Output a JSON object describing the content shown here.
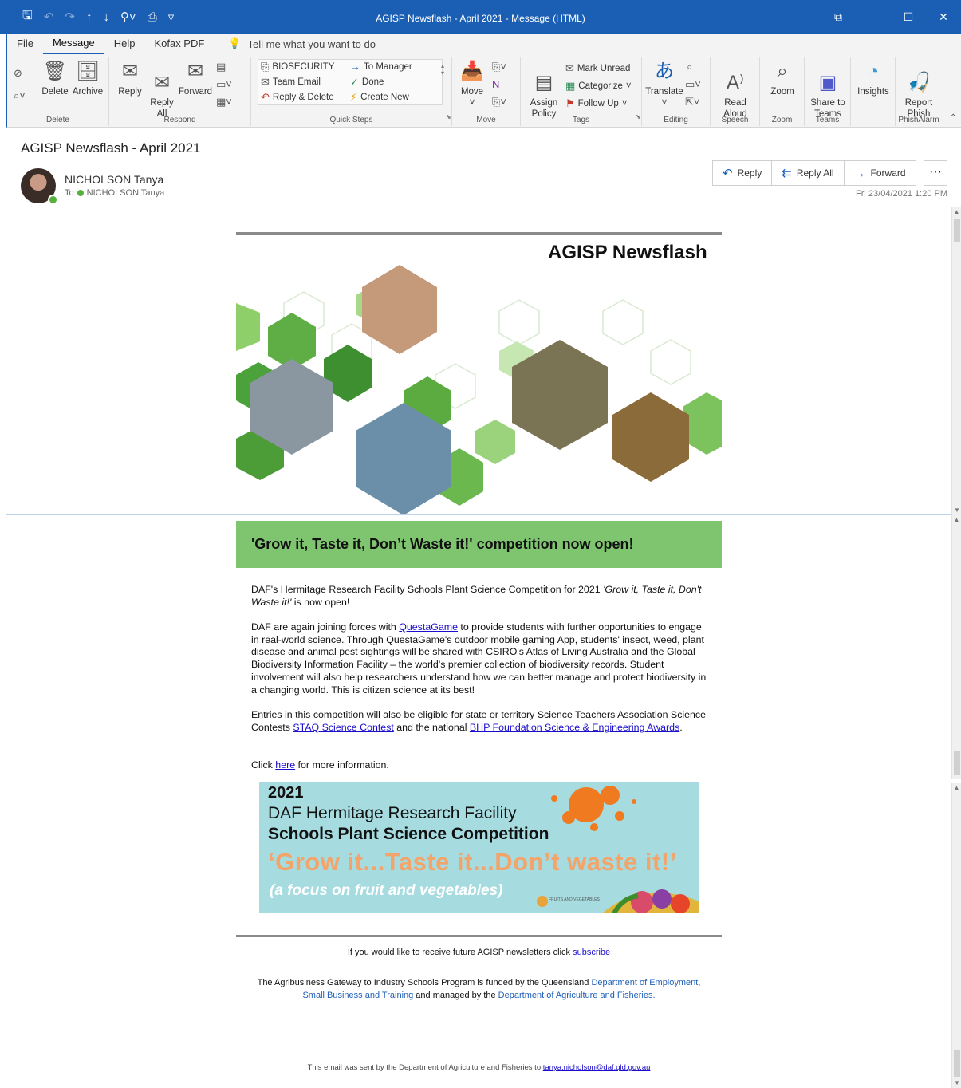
{
  "window": {
    "title": "AGISP Newsflash - April 2021  -  Message (HTML)"
  },
  "menu_tabs": [
    "File",
    "Message",
    "Help",
    "Kofax PDF"
  ],
  "tell_me": "Tell me what you want to do",
  "ribbon": {
    "delete": {
      "delete": "Delete",
      "archive": "Archive",
      "group": "Delete"
    },
    "respond": {
      "reply": "Reply",
      "reply_all": "Reply\nAll",
      "forward": "Forward",
      "group": "Respond"
    },
    "quick_steps": {
      "items": [
        "BIOSECURITY",
        "Team Email",
        "Reply & Delete",
        "To Manager",
        "Done",
        "Create New"
      ],
      "group": "Quick Steps"
    },
    "move": {
      "move": "Move",
      "group": "Move"
    },
    "tags": {
      "assign_policy": "Assign\nPolicy",
      "mark_unread": "Mark Unread",
      "categorize": "Categorize",
      "follow_up": "Follow Up",
      "group": "Tags"
    },
    "editing": {
      "translate": "Translate",
      "group": "Editing"
    },
    "speech": {
      "read_aloud": "Read\nAloud",
      "group": "Speech"
    },
    "zoom": {
      "zoom": "Zoom",
      "group": "Zoom"
    },
    "teams": {
      "share": "Share to\nTeams",
      "group": "Teams"
    },
    "insights": {
      "label": "Insights"
    },
    "phish": {
      "report": "Report\nPhish",
      "group": "PhishAlarm"
    }
  },
  "message": {
    "subject": "AGISP Newsflash - April 2021",
    "sender": "NICHOLSON Tanya",
    "to_label": "To",
    "recipient": "NICHOLSON Tanya",
    "timestamp": "Fri 23/04/2021 1:20 PM",
    "actions": {
      "reply": "Reply",
      "reply_all": "Reply All",
      "forward": "Forward",
      "more": "···"
    }
  },
  "newsletter": {
    "heading": "AGISP Newsflash",
    "banner_title": "'Grow it, Taste it, Don’t Waste it!' competition now open!",
    "p1_a": "DAF's Hermitage Research Facility Schools Plant Science Competition for 2021 ",
    "p1_em": "'Grow it, Taste it, Don't Waste it!'",
    "p1_b": " is now open!",
    "p2_a": "DAF are again joining forces with ",
    "p2_link": "QuestaGame",
    "p2_b": " to provide students with further opportunities to engage in real-world science. Through QuestaGame's outdoor mobile gaming App, students' insect, weed, plant disease and animal pest sightings will be shared with CSIRO's Atlas of Living Australia and the Global Biodiversity Information Facility – the world's premier collection of biodiversity records. Student involvement will also help researchers understand how we can better manage and protect biodiversity in a changing world. This is citizen science at its best!",
    "p3_a": "Entries in this competition will also be eligible for state or territory Science Teachers Association Science Contests ",
    "p3_link1": "STAQ Science Contest",
    "p3_b": " and the national ",
    "p3_link2": "BHP Foundation Science & Engineering Awards",
    "p3_c": ".",
    "p4_a": "Click ",
    "p4_link": "here",
    "p4_b": " for more information.",
    "comp": {
      "year": "2021",
      "facility": "DAF Hermitage Research Facility",
      "name": "Schools Plant Science Competition",
      "slogan": "‘Grow it...Taste it...Don’t waste it!’",
      "focus": "(a focus on fruit and vegetables)",
      "badge": "FRUITS AND VEGETABLES"
    },
    "subscribe_a": "If you would like to receive future AGISP newsletters click ",
    "subscribe_link": "subscribe",
    "funded_a": "The Agribusiness Gateway to Industry Schools Program is funded by the Queensland ",
    "funded_link1": "Department of Employment, Small Business and Training",
    "funded_b": " and managed by the ",
    "funded_link2": "Department of Agriculture and Fisheries.",
    "sent_a": "This email was sent by the Department of Agriculture and Fisheries to ",
    "sent_link": "tanya.nicholson@daf.qld.gov.au"
  },
  "colors": {
    "titlebar": "#1a5fb4",
    "banner_green": "#7fc56f",
    "comp_bg": "#a6dbe0",
    "slogan_orange": "#f3a46a"
  }
}
